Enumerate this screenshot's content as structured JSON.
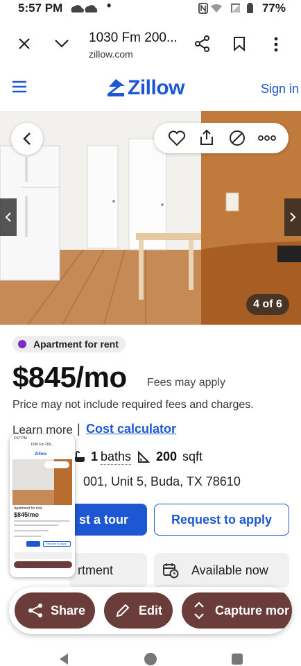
{
  "status": {
    "time": "5:57 PM",
    "dot": "•",
    "battery": "77%"
  },
  "browser": {
    "title": "1030 Fm 200...",
    "url": "zillow.com"
  },
  "header": {
    "logo": "Zillow",
    "signin": "Sign in"
  },
  "photo": {
    "counter": "4 of 6"
  },
  "listing": {
    "badge": "Apartment for rent",
    "price": "$845/mo",
    "fees": "Fees may apply",
    "note": "Price may not include required fees and charges.",
    "learn": "Learn more",
    "separator": "|",
    "calculator": "Cost calculator",
    "baths_num": "1",
    "baths_label": "baths",
    "sqft_num": "200",
    "sqft_label": "sqft",
    "address": "001, Unit 5, Buda, TX 78610",
    "tour_label": "st a tour",
    "apply_label": "Request to apply",
    "type_chip": "rtment",
    "availability": "Available now"
  },
  "sharebar": {
    "share": "Share",
    "edit": "Edit",
    "capture": "Capture mor"
  },
  "thumbnail": {
    "time": "5:57 PM",
    "title": "1030 Fm 200...",
    "logo": "Zillow",
    "badge": "Apartment for rent",
    "price": "$845/mo",
    "apply": "Request to apply"
  },
  "colors": {
    "accent": "#1d57d1",
    "pill": "#6b3d3a",
    "badge_dot": "#7a2cc4"
  }
}
